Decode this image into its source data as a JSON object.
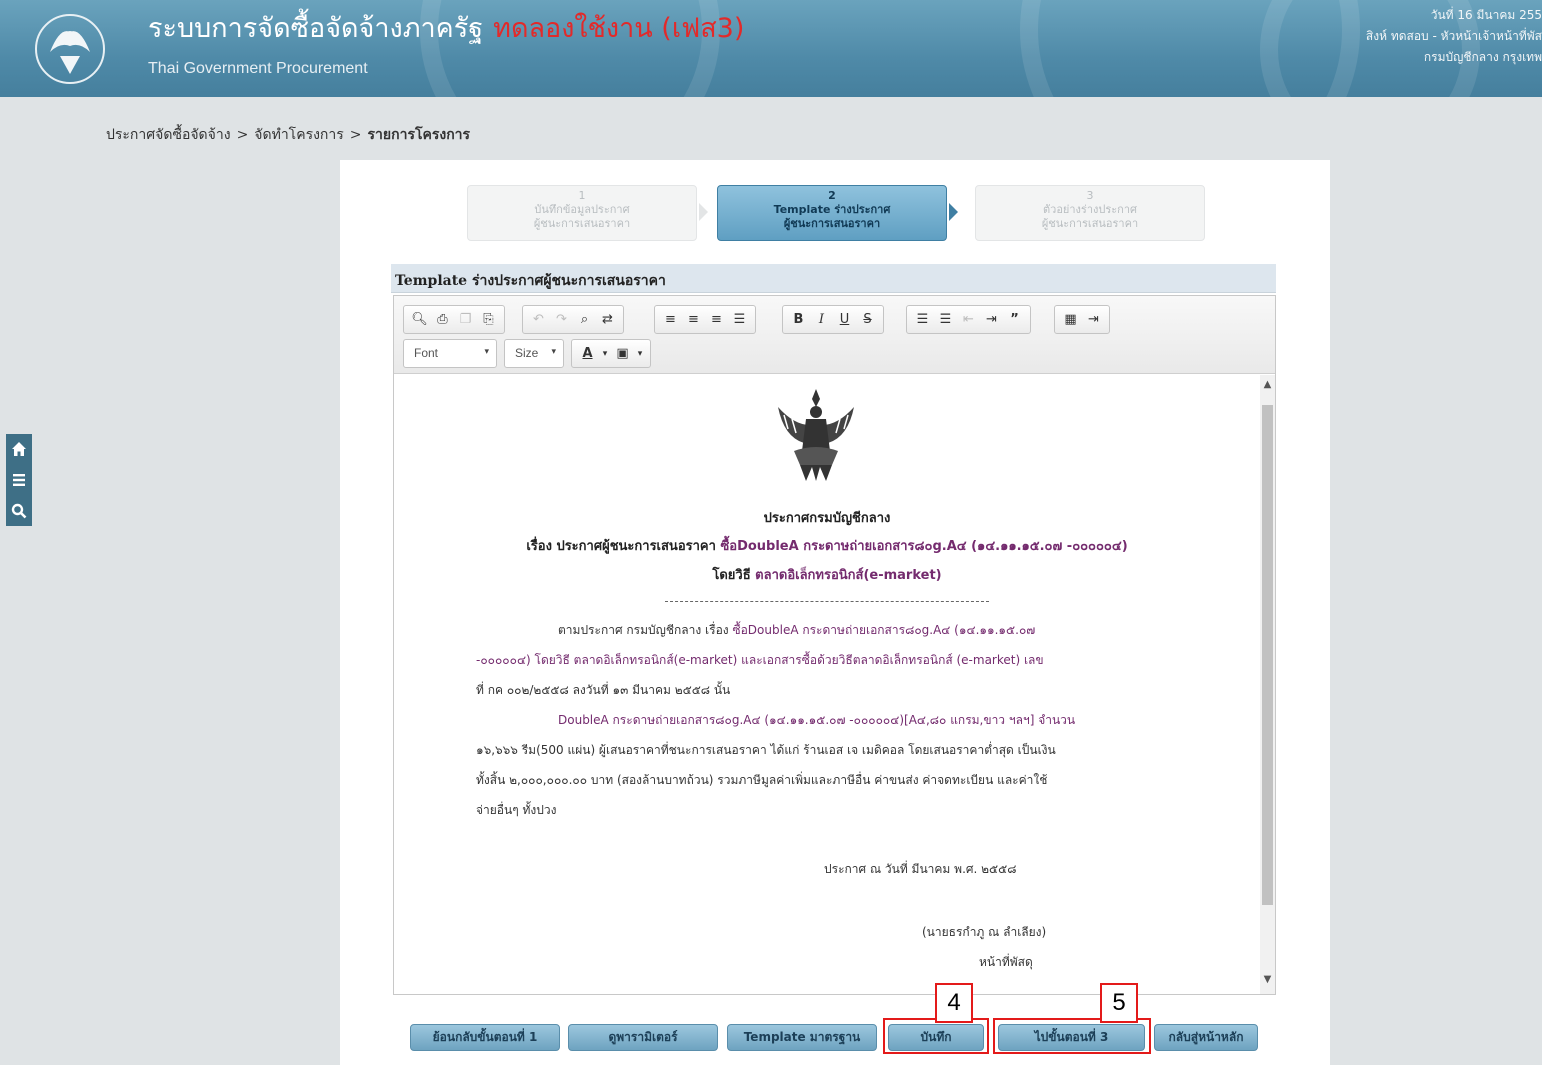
{
  "header": {
    "app_title": "ระบบการจัดซื้อจัดจ้างภาครัฐ",
    "trial_label": "ทดลองใช้งาน (เฟส3)",
    "subtitle": "Thai Government Procurement",
    "date": "วันที่ 16 มีนาคม 255",
    "user": "สิงห์ ทดสอบ - หัวหน้าเจ้าหน้าที่พัส",
    "department": "กรมบัญชีกลาง กรุงเทพ"
  },
  "breadcrumb": {
    "items": [
      "ประกาศจัดซื้อจัดจ้าง",
      "จัดทำโครงการ",
      "รายการโครงการ"
    ],
    "separator": ">"
  },
  "steps": [
    {
      "number": "1",
      "line1": "บันทึกข้อมูลประกาศ",
      "line2": "ผู้ชนะการเสนอราคา"
    },
    {
      "number": "2",
      "line1": "Template ร่างประกาศ",
      "line2": "ผู้ชนะการเสนอราคา"
    },
    {
      "number": "3",
      "line1": "ตัวอย่างร่างประกาศ",
      "line2": "ผู้ชนะการเสนอราคา"
    }
  ],
  "section_title": "Template ร่างประกาศผู้ชนะการเสนอราคา",
  "toolbar": {
    "font_label": "Font",
    "size_label": "Size"
  },
  "document": {
    "org": "ประกาศกรมบัญชีกลาง",
    "subject_label": "เรื่อง ประกาศผู้ชนะการเสนอราคา",
    "subject_item": "ซื้อDoubleA กระดาษถ่ายเอกสาร๘๐g.A๔ (๑๔.๑๑.๑๕.๐๗ -๐๐๐๐๐๔)",
    "method_label": "โดยวิธี",
    "method_value": "ตลาดอิเล็กทรอนิกส์(e-market)",
    "p1_line1_a": "ตามประกาศ กรมบัญชีกลาง เรื่อง ",
    "p1_line1_b": "ซื้อDoubleA กระดาษถ่ายเอกสาร๘๐g.A๔ (๑๔.๑๑.๑๕.๐๗",
    "p1_line2": "-๐๐๐๐๐๔) โดยวิธี ตลาดอิเล็กทรอนิกส์(e-market) และเอกสารซื้อด้วยวิธีตลาดอิเล็กทรอนิกส์ (e-market) เลข",
    "p1_line3": "ที่ กค ๐๐๒/๒๕๕๘ ลงวันที่ ๑๓ มีนาคม ๒๕๕๘ นั้น",
    "p2_line1": "DoubleA กระดาษถ่ายเอกสาร๘๐g.A๔ (๑๔.๑๑.๑๕.๐๗ -๐๐๐๐๐๔)[A๔,๘๐ แกรม,ขาว ฯลฯ] จำนวน",
    "p2_line2": "๑๖,๖๖๖ รีม(500 แผ่น) ผู้เสนอราคาที่ชนะการเสนอราคา ได้แก่ ร้านเอส เจ เมดิคอล โดยเสนอราคาต่ำสุด เป็นเงิน",
    "p2_line3": "ทั้งสิ้น ๒,๐๐๐,๐๐๐.๐๐ บาท (สองล้านบาทถ้วน) รวมภาษีมูลค่าเพิ่มและภาษีอื่น ค่าขนส่ง ค่าจดทะเบียน และค่าใช้",
    "p2_line4": "จ่ายอื่นๆ ทั้งปวง",
    "announce_date": "ประกาศ ณ วันที่   มีนาคม พ.ศ. ๒๕๕๘",
    "signer": "(นายธรกำภู ณ ลำเลียง)",
    "signer_title": "หน้าที่พัสดุ"
  },
  "buttons": {
    "back_step1": "ย้อนกลับขั้นตอนที่ 1",
    "view_params": "ดูพารามิเตอร์",
    "standard_template": "Template มาตรฐาน",
    "save": "บันทึก",
    "go_step3": "ไปขั้นตอนที่ 3",
    "home": "กลับสู่หน้าหลัก"
  },
  "callouts": {
    "save_number": "4",
    "step3_number": "5"
  },
  "colors": {
    "header": "#4f8aa8",
    "trial": "#e22a2a",
    "callout": "#e31a1a",
    "button": "#6ea3c0",
    "highlight_text": "#742b6e"
  },
  "icons": [
    "home-icon",
    "menu-icon",
    "search-icon"
  ]
}
